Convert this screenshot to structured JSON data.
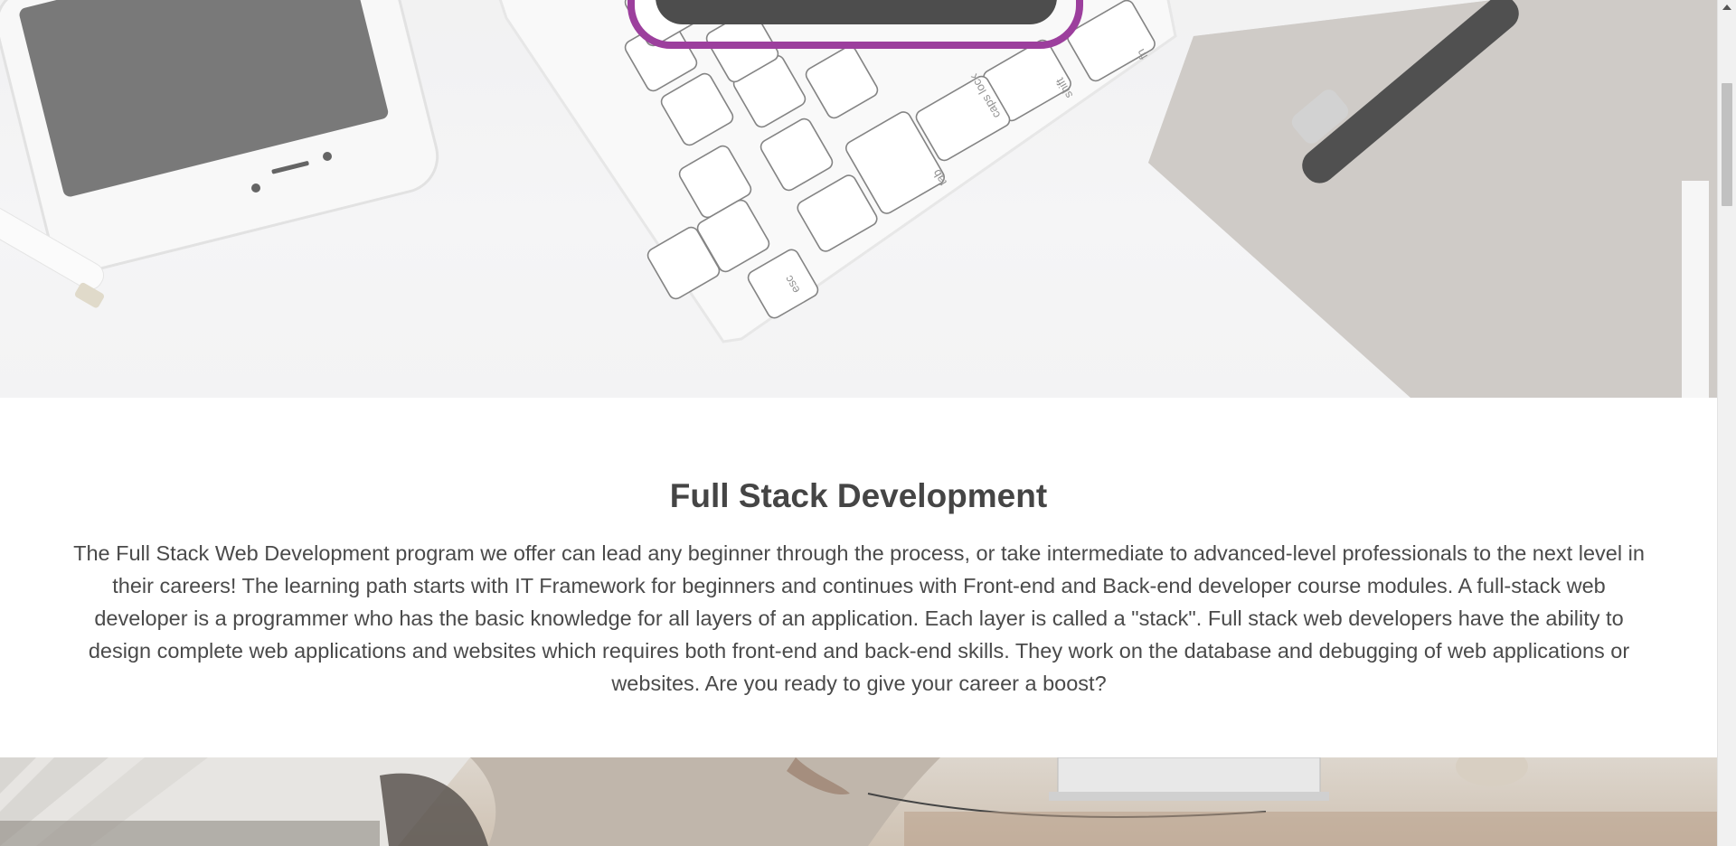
{
  "hero": {
    "image_alt": "Desk with phone, keyboard, notebook and pen",
    "keyboard_keys": [
      "esc",
      "tab",
      "caps lock",
      "shift",
      "fn"
    ],
    "accent_color": "#9c3f9d",
    "button_color": "#4d4d4d"
  },
  "section": {
    "title": "Full Stack Development",
    "description": "The Full Stack Web Development program we offer can lead any beginner through the process, or take intermediate to advanced-level professionals to the next level in their careers! The learning path starts with IT Framework for beginners and continues with Front-end and Back-end developer course modules. A full-stack web developer is a programmer who has the basic knowledge for all layers of an application. Each layer is called a \"stack\". Full stack web developers have the ability to design complete web applications and websites which requires both front-end and back-end skills. They work on the database and debugging of web applications or websites. Are you ready to give your career a boost?"
  },
  "bottom_image": {
    "image_alt": "Person working at a laptop on a wooden table"
  },
  "scrollbar": {
    "icon": "chevron-up-icon"
  }
}
